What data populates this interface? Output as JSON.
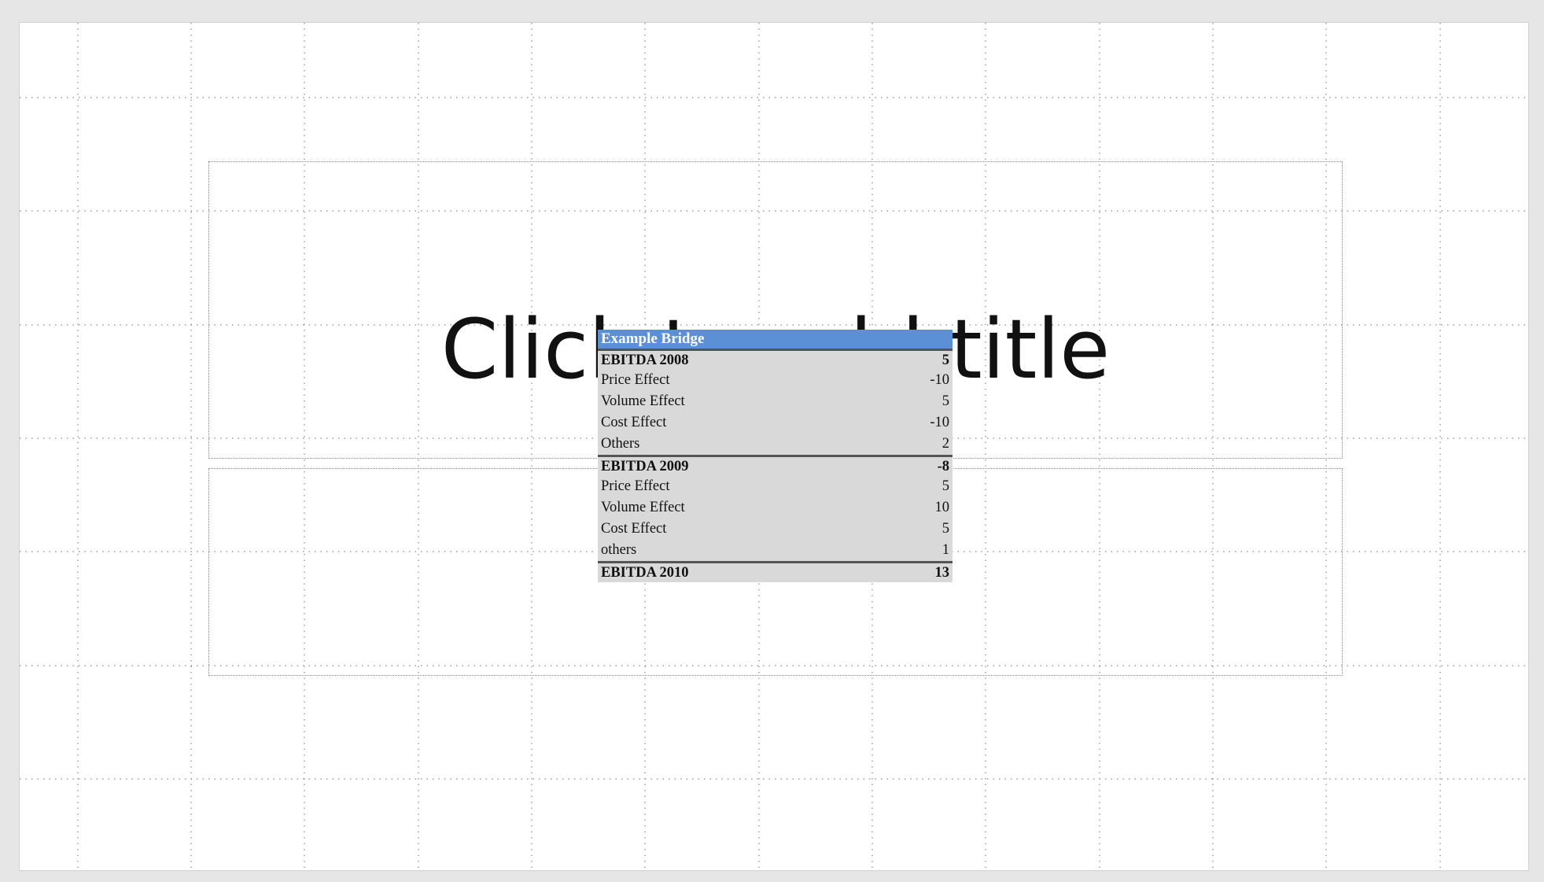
{
  "slide": {
    "title_placeholder": "Click to add title"
  },
  "bridge": {
    "title": "Example Bridge",
    "colors": {
      "header_bg": "#5b8fd6",
      "body_bg": "#d9d9d9"
    },
    "rows": [
      {
        "label": "EBITDA 2008",
        "value": "5",
        "total": true,
        "border": true
      },
      {
        "label": "Price Effect",
        "value": "-10",
        "total": false,
        "border": false
      },
      {
        "label": "Volume Effect",
        "value": "5",
        "total": false,
        "border": false
      },
      {
        "label": "Cost Effect",
        "value": "-10",
        "total": false,
        "border": false
      },
      {
        "label": "Others",
        "value": "2",
        "total": false,
        "border": false
      },
      {
        "label": "EBITDA 2009",
        "value": "-8",
        "total": true,
        "border": true
      },
      {
        "label": "Price Effect",
        "value": "5",
        "total": false,
        "border": false
      },
      {
        "label": "Volume Effect",
        "value": "10",
        "total": false,
        "border": false
      },
      {
        "label": "Cost Effect",
        "value": "5",
        "total": false,
        "border": false
      },
      {
        "label": "others",
        "value": "1",
        "total": false,
        "border": false
      },
      {
        "label": "EBITDA 2010",
        "value": "13",
        "total": true,
        "border": true
      }
    ]
  }
}
